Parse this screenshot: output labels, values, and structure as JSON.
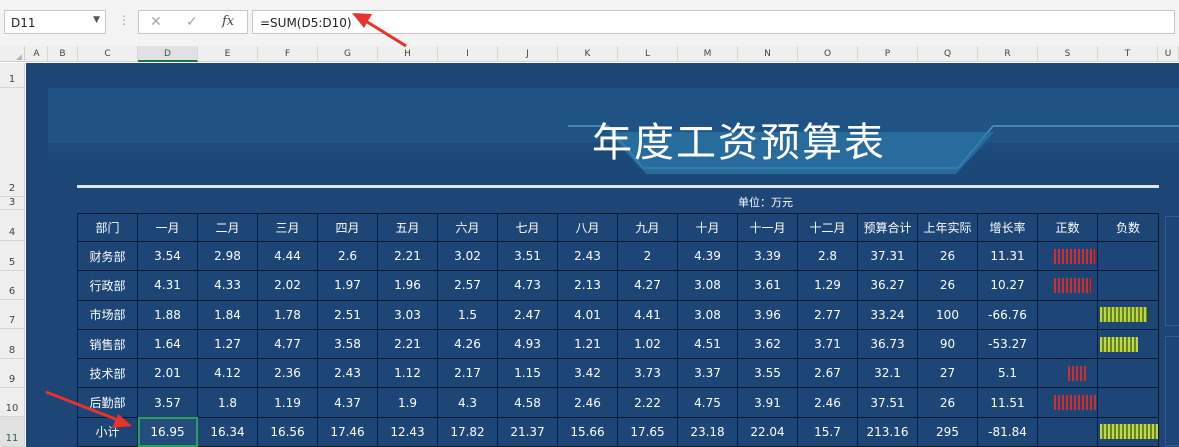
{
  "formula_bar": {
    "name_box": "D11",
    "cancel_icon": "✕",
    "enter_icon": "✓",
    "fx_label": "fx",
    "formula": "=SUM(D5:D10)"
  },
  "columns": [
    "A",
    "B",
    "C",
    "D",
    "E",
    "F",
    "G",
    "H",
    "I",
    "J",
    "K",
    "L",
    "M",
    "N",
    "O",
    "P",
    "Q",
    "R",
    "S",
    "T",
    "U"
  ],
  "selected_column": "D",
  "rows": [
    "1",
    "2",
    "3",
    "4",
    "5",
    "6",
    "7",
    "8",
    "9",
    "10",
    "11"
  ],
  "selected_row": "11",
  "sheet": {
    "title": "年度工资预算表",
    "unit_label": "单位：万元",
    "headers": [
      "部门",
      "一月",
      "二月",
      "三月",
      "四月",
      "五月",
      "六月",
      "七月",
      "八月",
      "九月",
      "十月",
      "十一月",
      "十二月",
      "预算合计",
      "上年实际",
      "增长率",
      "正数",
      "负数"
    ],
    "data_rows": [
      {
        "dept": "财务部",
        "months": [
          "3.54",
          "2.98",
          "4.44",
          "2.6",
          "2.21",
          "3.02",
          "3.51",
          "2.43",
          "2",
          "4.39",
          "3.39",
          "2.8"
        ],
        "total": "37.31",
        "last_year": "26",
        "growth": "11.31",
        "bar_sign": "pos",
        "bar_value": 11.31
      },
      {
        "dept": "行政部",
        "months": [
          "4.31",
          "4.33",
          "2.02",
          "1.97",
          "1.96",
          "2.57",
          "4.73",
          "2.13",
          "4.27",
          "3.08",
          "3.61",
          "1.29"
        ],
        "total": "36.27",
        "last_year": "26",
        "growth": "10.27",
        "bar_sign": "pos",
        "bar_value": 10.27
      },
      {
        "dept": "市场部",
        "months": [
          "1.88",
          "1.84",
          "1.78",
          "2.51",
          "3.03",
          "1.5",
          "2.47",
          "4.01",
          "4.41",
          "3.08",
          "3.96",
          "2.77"
        ],
        "total": "33.24",
        "last_year": "100",
        "growth": "-66.76",
        "bar_sign": "neg",
        "bar_value": -66.76
      },
      {
        "dept": "销售部",
        "months": [
          "1.64",
          "1.27",
          "4.77",
          "3.58",
          "2.21",
          "4.26",
          "4.93",
          "1.21",
          "1.02",
          "4.51",
          "3.62",
          "3.71"
        ],
        "total": "36.73",
        "last_year": "90",
        "growth": "-53.27",
        "bar_sign": "neg",
        "bar_value": -53.27
      },
      {
        "dept": "技术部",
        "months": [
          "2.01",
          "4.12",
          "2.36",
          "2.43",
          "1.12",
          "2.17",
          "1.15",
          "3.42",
          "3.73",
          "3.37",
          "3.55",
          "2.67"
        ],
        "total": "32.1",
        "last_year": "27",
        "growth": "5.1",
        "bar_sign": "pos",
        "bar_value": 5.1
      },
      {
        "dept": "后勤部",
        "months": [
          "3.57",
          "1.8",
          "1.19",
          "4.37",
          "1.9",
          "4.3",
          "4.58",
          "2.46",
          "2.22",
          "4.75",
          "3.91",
          "2.46"
        ],
        "total": "37.51",
        "last_year": "26",
        "growth": "11.51",
        "bar_sign": "pos",
        "bar_value": 11.51
      }
    ],
    "subtotal_row": {
      "dept": "小计",
      "months": [
        "16.95",
        "16.34",
        "16.56",
        "17.46",
        "12.43",
        "17.82",
        "21.37",
        "15.66",
        "17.65",
        "23.18",
        "22.04",
        "15.7"
      ],
      "total": "213.16",
      "last_year": "295",
      "growth": "-81.84",
      "bar_sign": "neg",
      "bar_value": -81.84
    }
  },
  "colors": {
    "dashboard_bg": "#1d4575",
    "positive_bar": "#d32d2d",
    "negative_bar": "#c9d246",
    "annotation_arrow": "#e8322c",
    "selection": "#2e9e5b"
  }
}
